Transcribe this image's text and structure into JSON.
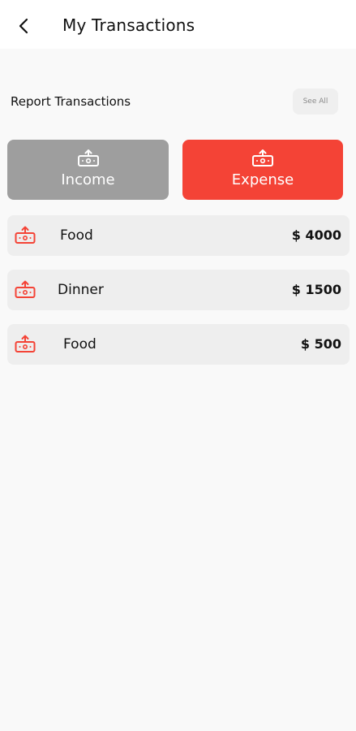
{
  "header": {
    "title": "My Transactions",
    "back_icon": "chevron-left-icon"
  },
  "section": {
    "label": "Report Transactions",
    "see_all": "See All"
  },
  "toggles": {
    "income": {
      "label": "Income",
      "icon": "money-upload-icon",
      "color": "#9e9e9e"
    },
    "expense": {
      "label": "Expense",
      "icon": "money-upload-icon",
      "color": "#f44336"
    }
  },
  "transactions": [
    {
      "name": "Food",
      "amount": "$ 4000",
      "icon": "money-upload-icon"
    },
    {
      "name": "Dinner",
      "amount": "$ 1500",
      "icon": "money-upload-icon"
    },
    {
      "name": "Food",
      "amount": "$ 500",
      "icon": "money-upload-icon"
    }
  ],
  "colors": {
    "accent": "#f44336",
    "muted": "#9e9e9e",
    "row_bg": "#eeeeee",
    "page_bg": "#f9f9f9"
  }
}
